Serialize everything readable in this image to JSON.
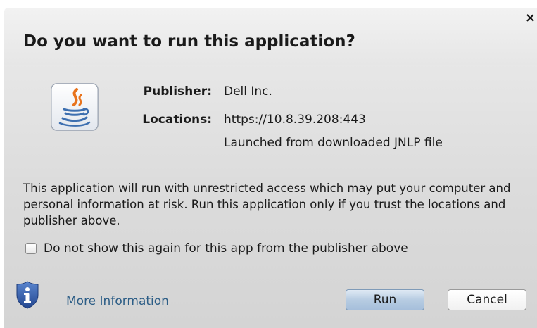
{
  "dialog": {
    "title": "Do you want to run this application?",
    "close_symbol": "×",
    "app_icon": "java-icon",
    "publisher_label": "Publisher:",
    "publisher_value": "Dell Inc.",
    "locations_label": "Locations:",
    "location_url": "https://10.8.39.208:443",
    "location_note": "Launched from downloaded JNLP file",
    "warning_text": "This application will run with unrestricted access which may put your computer and personal information at risk. Run this application only if you trust the locations and publisher above.",
    "checkbox_label": "Do not show this again for this app from the publisher above",
    "checkbox_checked": false,
    "more_info_icon": "shield-info-icon",
    "more_info_label": "More Information",
    "run_label": "Run",
    "cancel_label": "Cancel"
  },
  "colors": {
    "link": "#2c5d86",
    "shield": "#2f5aa8",
    "java_orange": "#e8731c",
    "java_blue": "#3d6fb0"
  }
}
